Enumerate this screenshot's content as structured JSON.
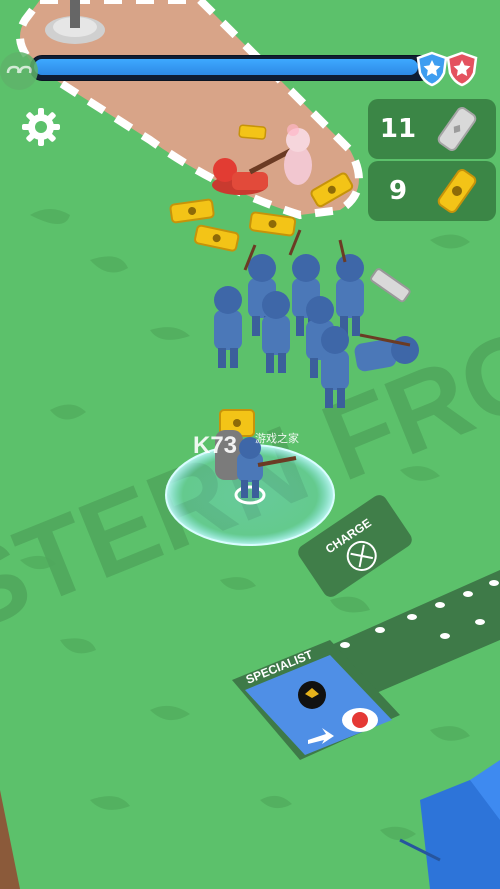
{
  "hud": {
    "level_progress": 0.98,
    "silver_count": "11",
    "gold_count": "9",
    "progress_color": "#2d8ae6",
    "shield_blue": "#3e9df0",
    "shield_red": "#e4525f"
  },
  "ground": {
    "banner_text": "WESTERN FRONT",
    "charge_label": "CHARGE",
    "specialist_label": "SPECIALIST"
  },
  "watermark": {
    "logo": "K73",
    "sub": "游戏之家"
  }
}
